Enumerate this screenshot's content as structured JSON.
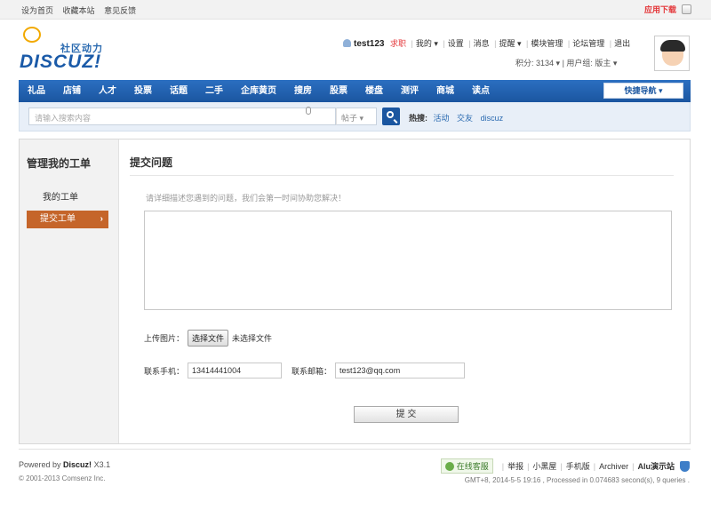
{
  "topbar": {
    "links": [
      "设为首页",
      "收藏本站",
      "意见反馈"
    ],
    "app_download": "应用下载"
  },
  "header": {
    "slogan": "社区动力",
    "brand": "DISCUZ!",
    "username": "test123",
    "job": "求职",
    "menu": [
      "我的 ▾",
      "设置",
      "消息",
      "提醒 ▾",
      "模块管理",
      "论坛管理",
      "退出"
    ],
    "points": "积分: 3134 ▾",
    "usergroup": "用户组: 版主 ▾"
  },
  "nav": {
    "items": [
      "礼品",
      "店铺",
      "人才",
      "投票",
      "话题",
      "二手",
      "企库黄页",
      "搜房",
      "股票",
      "楼盘",
      "测评",
      "商城",
      "读点"
    ],
    "quick_nav": "快捷导航 ▾"
  },
  "search": {
    "placeholder": "请输入搜索内容",
    "type": "帖子 ▾",
    "hot_label": "热搜:",
    "hot": [
      "活动",
      "交友",
      "discuz"
    ]
  },
  "sidebar": {
    "title": "管理我的工单",
    "my_tickets": "我的工单",
    "submit_ticket": "提交工单",
    "arrow": "›"
  },
  "form": {
    "title": "提交问题",
    "hint": "请详细描述您遇到的问题，我们会第一时间协助您解决！",
    "upload_label": "上传图片：",
    "choose_file": "选择文件",
    "no_file": "未选择文件",
    "phone_label": "联系手机：",
    "phone_value": "13414441004",
    "email_label": "联系邮箱：",
    "email_value": "test123@qq.com",
    "submit": "提 交"
  },
  "footer": {
    "powered_prefix": "Powered by",
    "powered_brand": "Discuz!",
    "powered_version": "X3.1",
    "copyright": "© 2001-2013 Comsenz Inc.",
    "online": "在线客服",
    "links": [
      "举报",
      "小黑屋",
      "手机版",
      "Archiver",
      "Alu演示站"
    ],
    "gmt": "GMT+8, 2014-5-5 19:16 , Processed in 0.074683 second(s), 9 queries ."
  }
}
